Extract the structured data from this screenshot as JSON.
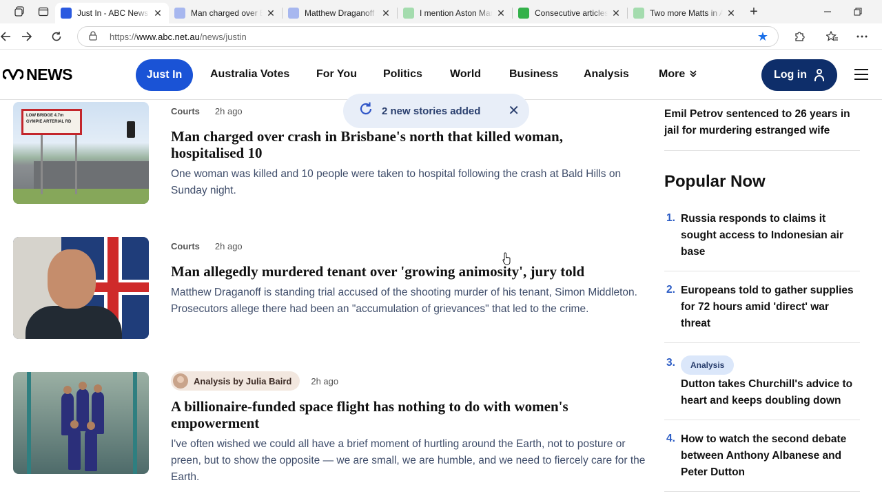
{
  "browser": {
    "tabs": [
      {
        "title": "Just In - ABC News",
        "active": true,
        "favicon": "abc"
      },
      {
        "title": "Man charged over B",
        "active": false,
        "favicon": "abc-light"
      },
      {
        "title": "Matthew Draganoff",
        "active": false,
        "favicon": "abc-light"
      },
      {
        "title": "I mention Aston Mar",
        "active": false,
        "favicon": "green-light"
      },
      {
        "title": "Consecutive articles",
        "active": false,
        "favicon": "green"
      },
      {
        "title": "Two more Matts in A",
        "active": false,
        "favicon": "green-light"
      }
    ],
    "url": {
      "scheme": "https://",
      "host": "www.abc.net.au",
      "path": "/news/justin"
    }
  },
  "site": {
    "logo_mark": "ABC",
    "logo_text": "NEWS",
    "nav": [
      {
        "label": "Just In",
        "active": true
      },
      {
        "label": "Australia Votes"
      },
      {
        "label": "For You"
      },
      {
        "label": "Politics"
      },
      {
        "label": "World"
      },
      {
        "label": "Business"
      },
      {
        "label": "Analysis"
      },
      {
        "label": "More"
      }
    ],
    "login_label": "Log in"
  },
  "notification": {
    "text": "2 new stories added"
  },
  "articles": [
    {
      "tag": "Courts",
      "time": "2h ago",
      "headline": "Man charged over crash in Brisbane's north that killed woman, hospitalised 10",
      "summary": "One woman was killed and 10 people were taken to hospital following the crash at Bald Hills on Sunday night.",
      "sign_text": "LOW BRIDGE 4.7m GYMPIE ARTERIAL RD"
    },
    {
      "tag": "Courts",
      "time": "2h ago",
      "headline": "Man allegedly murdered tenant over 'growing animosity', jury told",
      "summary": "Matthew Draganoff is standing trial accused of the shooting murder of his tenant, Simon Middleton. Prosecutors allege there had been an \"accumulation of grievances\" that led to the crime."
    },
    {
      "tag": "Analysis by Julia Baird",
      "time": "2h ago",
      "headline": "A billionaire-funded space flight has nothing to do with women's empowerment",
      "summary": "I've often wished we could all have a brief moment of hurtling around the Earth, not to posture or preen, but to show the opposite — we are small, we are humble, and we need to fiercely care for the Earth."
    }
  ],
  "sidebar": {
    "top_story": "Emil Petrov sentenced to 26 years in jail for murdering estranged wife",
    "popular_title": "Popular Now",
    "popular": [
      {
        "num": "1.",
        "text": "Russia responds to claims it sought access to Indonesian air base",
        "badge": ""
      },
      {
        "num": "2.",
        "text": "Europeans told to gather supplies for 72 hours amid 'direct' war threat",
        "badge": ""
      },
      {
        "num": "3.",
        "text": "Dutton takes Churchill's advice to heart and keeps doubling down",
        "badge": "Analysis"
      },
      {
        "num": "4.",
        "text": "How to watch the second debate between Anthony Albanese and Peter Dutton",
        "badge": ""
      }
    ]
  },
  "colors": {
    "accent": "#1a53d6",
    "login": "#0e2e6a",
    "summary_text": "#3f4d6a"
  }
}
